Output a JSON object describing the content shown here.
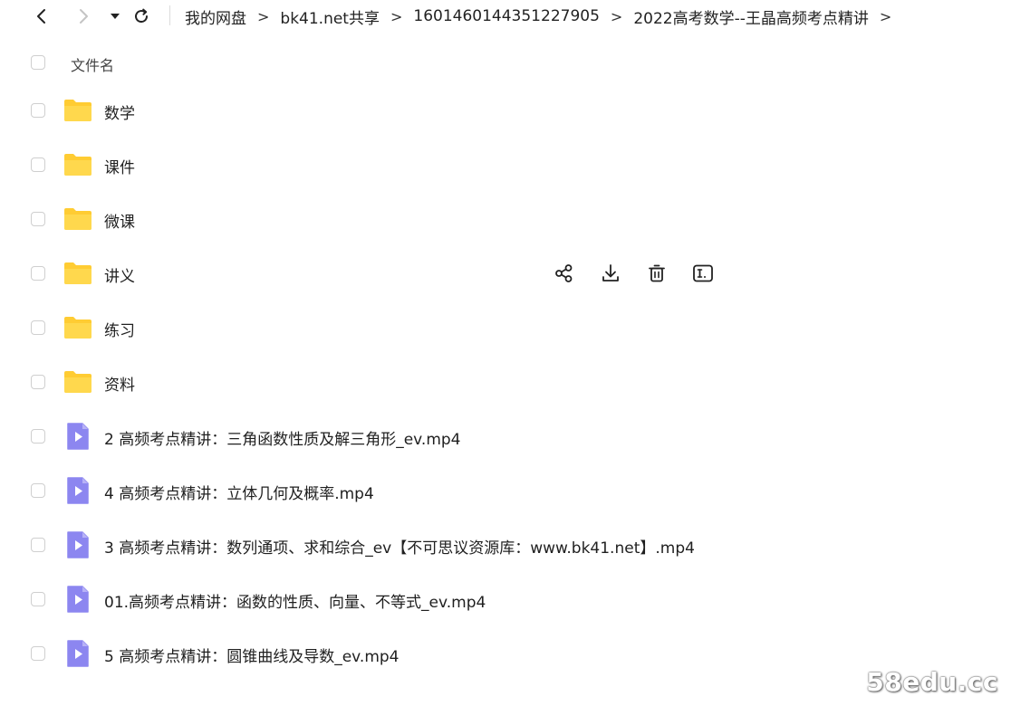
{
  "navigation": {
    "breadcrumb": [
      "我的网盘",
      "bk41.net共享",
      "1601460144351227905",
      "2022高考数学--王晶高频考点精讲"
    ],
    "separator": ">"
  },
  "header": {
    "column_name": "文件名"
  },
  "files": [
    {
      "name": "数学",
      "type": "folder"
    },
    {
      "name": "课件",
      "type": "folder"
    },
    {
      "name": "微课",
      "type": "folder"
    },
    {
      "name": "讲义",
      "type": "folder"
    },
    {
      "name": "练习",
      "type": "folder"
    },
    {
      "name": "资料",
      "type": "folder"
    },
    {
      "name": "2 高频考点精讲：三角函数性质及解三角形_ev.mp4",
      "type": "video"
    },
    {
      "name": "4 高频考点精讲：立体几何及概率.mp4",
      "type": "video"
    },
    {
      "name": "3 高频考点精讲：数列通项、求和综合_ev【不可思议资源库：www.bk41.net】.mp4",
      "type": "video"
    },
    {
      "name": "01.高频考点精讲：函数的性质、向量、不等式_ev.mp4",
      "type": "video"
    },
    {
      "name": "5 高频考点精讲：圆锥曲线及导数_ev.mp4",
      "type": "video"
    }
  ],
  "hovered_row_index": 3,
  "row_actions": [
    "share-icon",
    "download-icon",
    "delete-icon",
    "rename-icon"
  ],
  "icons": {
    "back": "chevron-left-icon",
    "forward": "chevron-right-icon",
    "history": "caret-down-icon",
    "refresh": "refresh-icon",
    "folder": "folder-icon",
    "video": "video-file-icon"
  },
  "colors": {
    "folder": "#FFCC33",
    "video": "#8C86F0",
    "text": "#1f1f1f"
  },
  "watermark": "58edu.cc"
}
